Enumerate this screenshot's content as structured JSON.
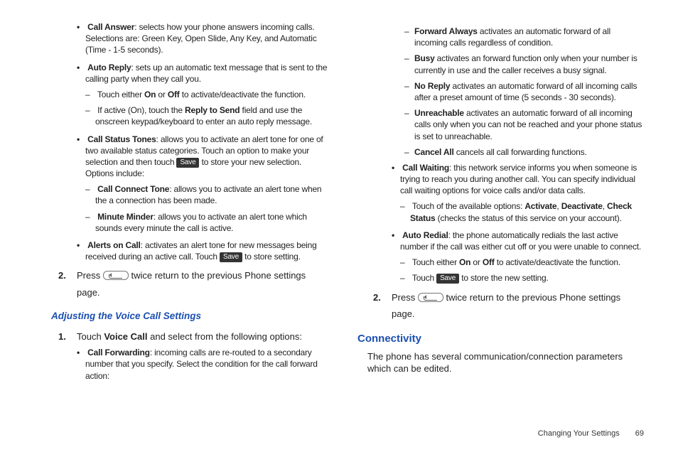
{
  "left": {
    "items": [
      {
        "term": "Call Answer",
        "desc": ": selects how your phone answers incoming calls. Selections are: Green Key, Open Slide, Any Key, and Automatic (Time - 1-5 seconds)."
      },
      {
        "term": "Auto Reply",
        "desc": ": sets up an automatic text message that is sent to the calling party when they call you.",
        "sub": [
          {
            "pre": "Touch either ",
            "b1": "On",
            "mid": " or ",
            "b2": "Off",
            "post": " to activate/deactivate the function."
          },
          {
            "pre": "If active (On), touch the ",
            "b1": "Reply to Send",
            "post": " field and use the onscreen keypad/keyboard to enter an auto reply message."
          }
        ]
      },
      {
        "term": "Call Status Tones",
        "desc": ": allows you to activate an alert tone for one of two available status categories. Touch an option to make your selection and then touch ",
        "save": true,
        "desc2": " to store your new selection. Options include:",
        "sub": [
          {
            "b1": "Call Connect Tone",
            "post": ": allows you to activate an alert tone when the a connection has been made."
          },
          {
            "b1": "Minute Minder",
            "post": ": allows you to activate an alert tone which sounds every minute the call is active."
          }
        ]
      },
      {
        "term": "Alerts on Call",
        "desc": ": activates an alert tone for new messages being received during an active call. Touch ",
        "save": true,
        "desc2": " to store setting."
      }
    ],
    "step2": {
      "num": "2.",
      "pre": "Press ",
      "post": " twice return to the previous Phone settings",
      "trail": "page."
    },
    "subhead": "Adjusting the Voice Call Settings",
    "step1": {
      "num": "1.",
      "pre": "Touch ",
      "b1": "Voice Call",
      "post": " and select from the following options:"
    },
    "callfwd": {
      "term": "Call Forwarding",
      "desc": ": incoming calls are re-routed to a secondary number that you specify. Select the condition for the call forward action:"
    }
  },
  "right": {
    "fwd": [
      {
        "b1": "Forward Always",
        "post": " activates an automatic forward of all incoming calls regardless of condition."
      },
      {
        "b1": "Busy",
        "post": " activates an forward function only when your number is currently in use and the caller receives a busy signal."
      },
      {
        "b1": "No Reply",
        "post": " activates an automatic forward of all incoming calls after a preset amount of time (5 seconds - 30 seconds)."
      },
      {
        "b1": "Unreachable",
        "post": " activates an automatic forward of all incoming calls only when you can not be reached and your phone status is set to unreachable."
      },
      {
        "b1": "Cancel All",
        "post": " cancels all call forwarding functions."
      }
    ],
    "callwait": {
      "term": "Call Waiting",
      "desc": ": this network service informs you when someone is trying to reach you during another call. You can specify individual call waiting options for voice calls and/or data calls.",
      "sub": {
        "pre": "Touch of the available options: ",
        "b1": "Activate",
        "s1": ", ",
        "b2": "Deactivate",
        "s2": ", ",
        "b3": "Check Status",
        "post": " (checks the status of this service on your account)."
      }
    },
    "autoredial": {
      "term": "Auto Redial",
      "desc": ": the phone automatically redials the last active number if the call was either cut off or you were unable to connect.",
      "sub": [
        {
          "pre": "Touch either ",
          "b1": "On",
          "mid": " or ",
          "b2": "Off",
          "post": " to activate/deactivate the function."
        },
        {
          "pre": "Touch ",
          "save": true,
          "post": " to store the new setting."
        }
      ]
    },
    "step2": {
      "num": "2.",
      "pre": "Press ",
      "post": " twice return to the previous Phone settings",
      "trail": "page."
    },
    "sechead": "Connectivity",
    "secdesc": "The phone has several communication/connection parameters which can be edited."
  },
  "footer": {
    "title": "Changing Your Settings",
    "page": "69"
  },
  "ui": {
    "save": "Save"
  }
}
